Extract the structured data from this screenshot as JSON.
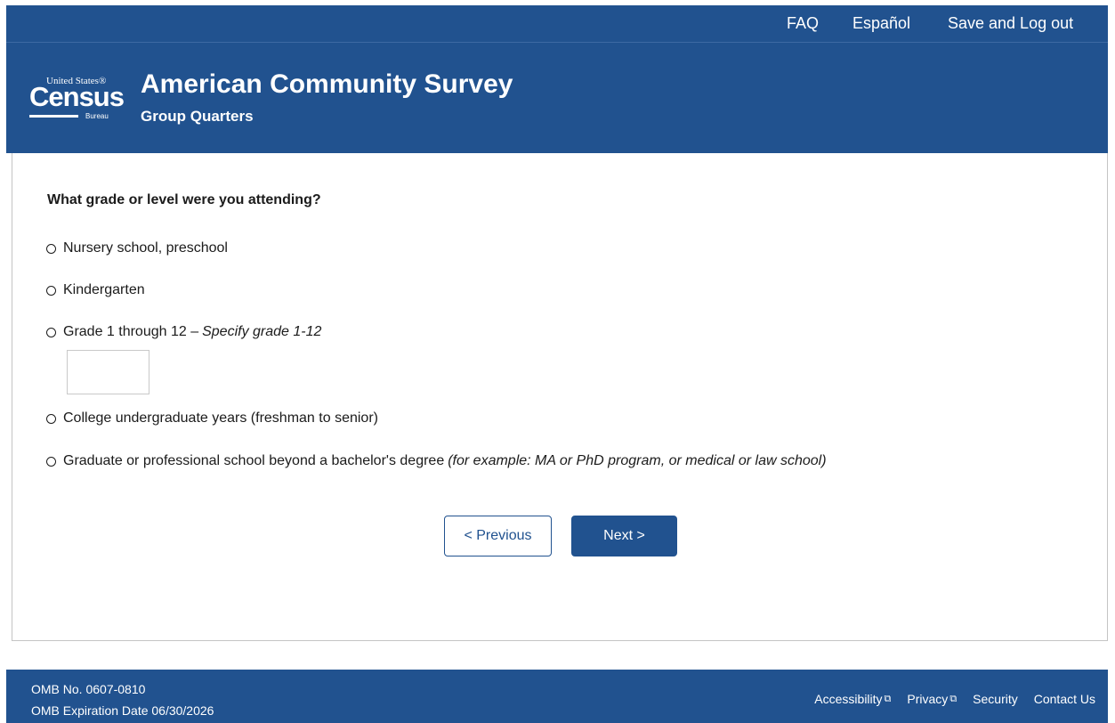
{
  "topnav": {
    "faq": "FAQ",
    "espanol": "Español",
    "logout": "Save and Log out"
  },
  "header": {
    "logo_line1": "United States®",
    "logo_line2": "Census",
    "logo_line3": "Bureau",
    "title": "American Community Survey",
    "subtitle": "Group Quarters"
  },
  "question": {
    "text": "What grade or level were you attending?",
    "options": [
      {
        "label": "Nursery school, preschool",
        "note": ""
      },
      {
        "label": "Kindergarten",
        "note": ""
      },
      {
        "label": "Grade 1 through 12 –",
        "note": "Specify grade 1-12"
      },
      {
        "label": "College undergraduate years (freshman to senior)",
        "note": ""
      },
      {
        "label": "Graduate or professional school beyond a bachelor's degree",
        "note": "(for example: MA or PhD program, or medical or law school)"
      }
    ],
    "grade_input_value": ""
  },
  "buttons": {
    "previous": "< Previous",
    "next": "Next >"
  },
  "footer": {
    "omb_number": "OMB No. 0607-0810",
    "omb_expiration": "OMB Expiration Date 06/30/2026",
    "links": {
      "accessibility": "Accessibility",
      "privacy": "Privacy",
      "security": "Security",
      "contact": "Contact Us"
    },
    "external_icon": "⧉"
  },
  "colors": {
    "brand_blue": "#21528f",
    "text": "#1b1b1b",
    "border": "#c4c4c4"
  }
}
